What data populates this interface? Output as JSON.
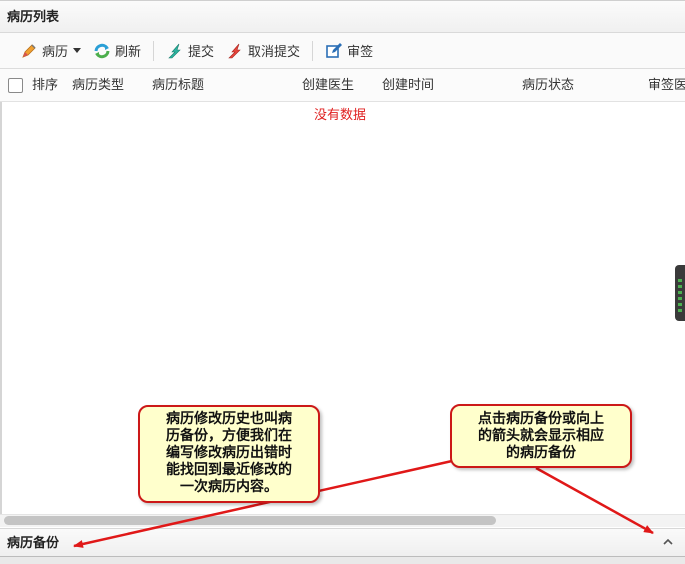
{
  "panel": {
    "title": "病历列表"
  },
  "toolbar": {
    "record_label": "病历",
    "refresh_label": "刷新",
    "submit_label": "提交",
    "cancel_submit_label": "取消提交",
    "review_label": "审签"
  },
  "table": {
    "columns": [
      "排序",
      "病历类型",
      "病历标题",
      "创建医生",
      "创建时间",
      "病历状态",
      "审签医"
    ],
    "empty_text": "没有数据"
  },
  "footer": {
    "title": "病历备份"
  },
  "annotations": {
    "left_note": [
      "病历修改历史也叫病",
      "历备份，方便我们在",
      "编写修改病历出错时",
      "能找回到最近修改的",
      "一次病历内容。"
    ],
    "right_note": [
      "点击病历备份或向上",
      "的箭头就会显示相应",
      "的病历备份"
    ]
  },
  "colors": {
    "annotation_border": "#cc1818",
    "annotation_fill": "#ffffcc",
    "empty_text": "#e02020"
  },
  "icons": [
    "pencil-icon",
    "refresh-icon",
    "submit-icon",
    "cancel-submit-icon",
    "edit-sign-icon",
    "chevron-up-icon"
  ]
}
